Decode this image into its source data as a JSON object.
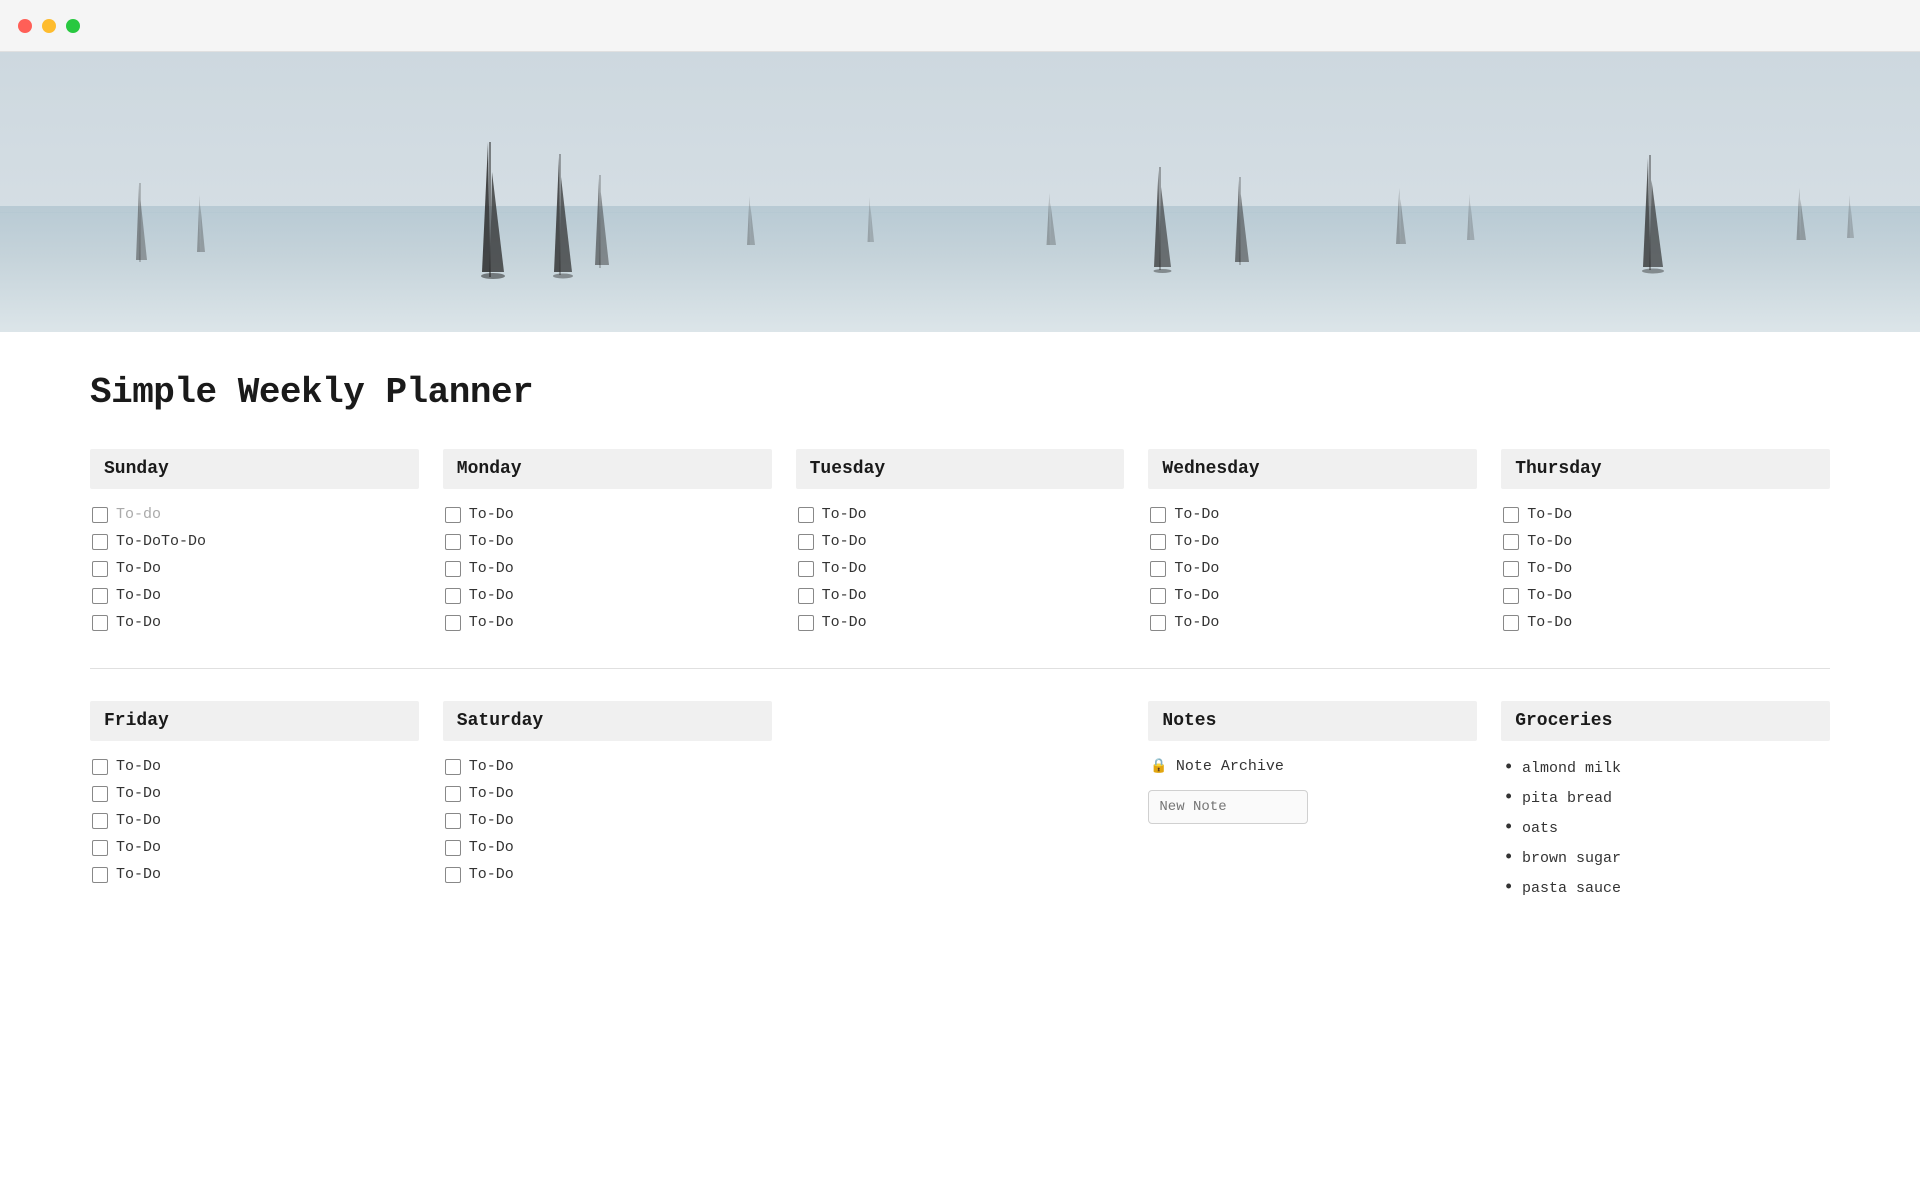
{
  "titlebar": {
    "buttons": [
      "close",
      "minimize",
      "maximize"
    ]
  },
  "hero": {
    "alt": "Sailboats on ocean"
  },
  "page": {
    "title": "Simple Weekly Planner"
  },
  "days": [
    {
      "name": "Sunday",
      "items": [
        {
          "text": "To-do",
          "placeholder": true
        },
        {
          "text": "To-DoTo-Do",
          "placeholder": false
        },
        {
          "text": "To-Do",
          "placeholder": false
        },
        {
          "text": "To-Do",
          "placeholder": false
        },
        {
          "text": "To-Do",
          "placeholder": false
        }
      ]
    },
    {
      "name": "Monday",
      "items": [
        {
          "text": "To-Do",
          "placeholder": false
        },
        {
          "text": "To-Do",
          "placeholder": false
        },
        {
          "text": "To-Do",
          "placeholder": false
        },
        {
          "text": "To-Do",
          "placeholder": false
        },
        {
          "text": "To-Do",
          "placeholder": false
        }
      ]
    },
    {
      "name": "Tuesday",
      "items": [
        {
          "text": "To-Do",
          "placeholder": false
        },
        {
          "text": "To-Do",
          "placeholder": false
        },
        {
          "text": "To-Do",
          "placeholder": false
        },
        {
          "text": "To-Do",
          "placeholder": false
        },
        {
          "text": "To-Do",
          "placeholder": false
        }
      ]
    },
    {
      "name": "Wednesday",
      "items": [
        {
          "text": "To-Do",
          "placeholder": false
        },
        {
          "text": "To-Do",
          "placeholder": false
        },
        {
          "text": "To-Do",
          "placeholder": false
        },
        {
          "text": "To-Do",
          "placeholder": false
        },
        {
          "text": "To-Do",
          "placeholder": false
        }
      ]
    },
    {
      "name": "Thursday",
      "items": [
        {
          "text": "To-Do",
          "placeholder": false
        },
        {
          "text": "To-Do",
          "placeholder": false
        },
        {
          "text": "To-Do",
          "placeholder": false
        },
        {
          "text": "To-Do",
          "placeholder": false
        },
        {
          "text": "To-Do",
          "placeholder": false
        }
      ]
    }
  ],
  "days2": [
    {
      "name": "Friday",
      "items": [
        {
          "text": "To-Do"
        },
        {
          "text": "To-Do"
        },
        {
          "text": "To-Do"
        },
        {
          "text": "To-Do"
        },
        {
          "text": "To-Do"
        }
      ]
    },
    {
      "name": "Saturday",
      "items": [
        {
          "text": "To-Do"
        },
        {
          "text": "To-Do"
        },
        {
          "text": "To-Do"
        },
        {
          "text": "To-Do"
        },
        {
          "text": "To-Do"
        }
      ]
    }
  ],
  "notes": {
    "header": "Notes",
    "archive_label": "Note Archive",
    "new_note_placeholder": "New Note"
  },
  "groceries": {
    "header": "Groceries",
    "items": [
      "almond milk",
      "pita bread",
      "oats",
      "brown sugar",
      "pasta sauce"
    ]
  }
}
